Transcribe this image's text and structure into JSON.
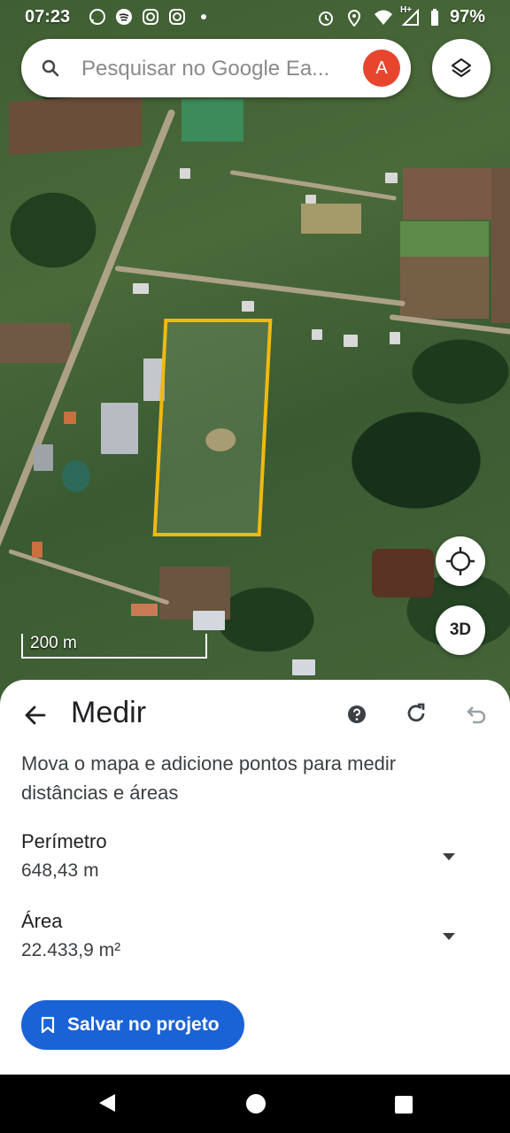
{
  "status_bar": {
    "time": "07:23",
    "battery": "97%",
    "icons_left": [
      "whatsapp-icon",
      "spotify-icon",
      "instagram-icon",
      "instagram-icon",
      "dot-icon"
    ],
    "icons_right": [
      "alarm-icon",
      "location-icon",
      "wifi-icon",
      "signal-icon",
      "battery-icon"
    ],
    "network_label": "H+"
  },
  "search": {
    "placeholder": "Pesquisar no Google Ea...",
    "avatar_initial": "A"
  },
  "map": {
    "scale_label": "200 m",
    "three_d_label": "3D",
    "parcel_outline_color": "#f1b90f"
  },
  "sheet": {
    "title": "Medir",
    "description": "Mova o mapa e adicione pontos para medir distâncias e áreas",
    "perimeter": {
      "label": "Perímetro",
      "value": "648,43 m"
    },
    "area": {
      "label": "Área",
      "value": "22.433,9 m²"
    },
    "save_label": "Salvar no projeto"
  },
  "colors": {
    "accent": "#1a63d6",
    "avatar": "#e8452f"
  }
}
